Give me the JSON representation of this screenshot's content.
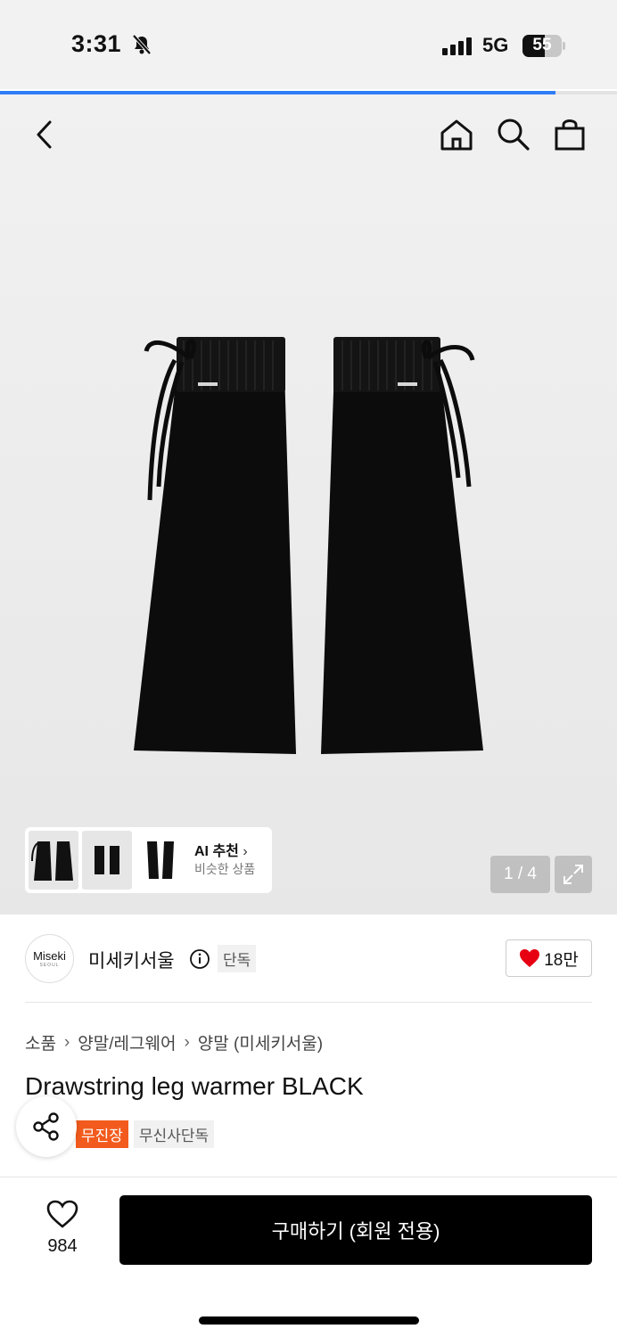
{
  "status_bar": {
    "time": "3:31",
    "network": "5G",
    "battery": "55"
  },
  "loading_progress": 0.9,
  "nav": {
    "icons": [
      "back-icon",
      "home-icon",
      "search-icon",
      "bag-icon"
    ]
  },
  "gallery": {
    "ai_title": "AI 추천",
    "ai_subtitle": "비슷한 상품",
    "counter": "1 / 4"
  },
  "brand": {
    "logo_line1": "Miseki",
    "logo_line2": "SEOUL",
    "name": "미세키서울",
    "tag": "단독",
    "likes": "18만"
  },
  "breadcrumb": [
    "소품",
    "양말/레그웨어",
    "양말 (미세키서울)"
  ],
  "product": {
    "title": "Drawstring leg warmer BLACK",
    "tags": [
      "무진장",
      "무신사단독"
    ]
  },
  "bottom": {
    "wish_count": "984",
    "buy_label": "구매하기 (회원 전용)"
  },
  "colors": {
    "accent_blue": "#2f7df6",
    "tag_orange": "#f25b1d",
    "heart_red": "#e60012"
  }
}
